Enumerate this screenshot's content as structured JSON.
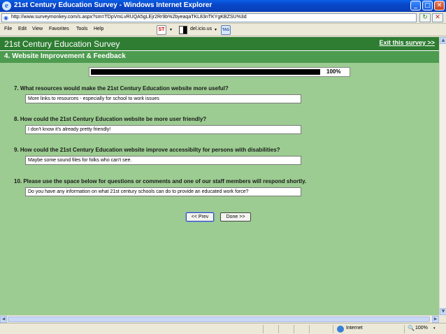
{
  "window": {
    "title": "21st Century Education Survey - Windows Internet Explorer",
    "controls": {
      "minimize": "_",
      "maximize": "□",
      "close": "✕"
    }
  },
  "address": {
    "url": "http://www.surveymonkey.com/s.aspx?sm=TDpVmLvRUQA5gLEjr2Rr9b%2byeaqaTKL83nTKYgKBZSU%3d"
  },
  "menu": {
    "items": [
      "File",
      "Edit",
      "View",
      "Favorites",
      "Tools",
      "Help"
    ],
    "delicious_label": "del.icio.us",
    "addon_text": "ST",
    "tag_text": "TAG",
    "arrow": "▾"
  },
  "survey": {
    "title": "21st Century Education Survey",
    "exit_link": "Exit this survey >>",
    "section": "4. Website Improvement & Feedback",
    "progress": {
      "percent": 1.0,
      "label": "100%"
    },
    "questions": [
      {
        "label": "7. What resources would make the 21st Century Education website more useful?",
        "answer": "More links to resources - especially for school to work issues"
      },
      {
        "label": "8. How could the 21st Century Education website be more user friendly?",
        "answer": "I don't know it's already pretty friendly!"
      },
      {
        "label": "9. How could the 21st Century Education website improve accessibilty for persons with disabilities?",
        "answer": "Maybe some sound files for folks who can't see."
      },
      {
        "label": "10. Please use the space below for questions or comments and one of our staff members will respond shortly.",
        "answer": "Do you have any information on what 21st century schools can do to provide an educated work force?"
      }
    ],
    "prev_button": "<< Prev",
    "done_button": "Done >>"
  },
  "status": {
    "zone": "Internet",
    "zoom": "100%"
  },
  "colors": {
    "page_bg": "#9ccc91",
    "header_bg": "#2e7d32",
    "section_bg": "#4c9b4f"
  }
}
